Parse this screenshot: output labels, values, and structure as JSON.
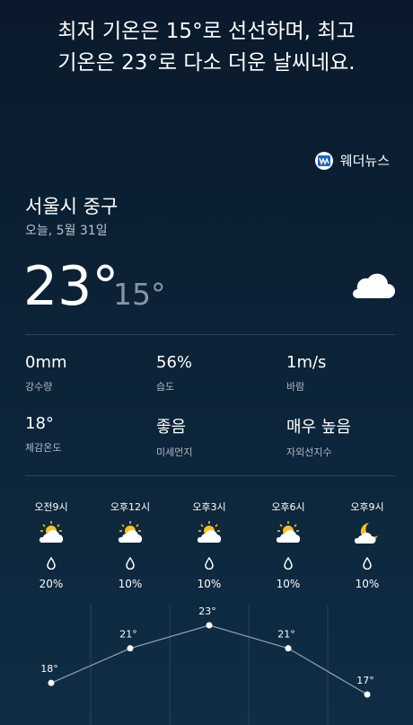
{
  "summary": {
    "line1": "최저 기온은 15°로 선선하며, 최고",
    "line2": "기온은 23°로 다소 더운 날씨네요."
  },
  "brand": {
    "name": "웨더뉴스",
    "icon": "weathernews-logo-icon"
  },
  "location": {
    "name": "서울시 중구",
    "date": "오늘, 5월 31일"
  },
  "current": {
    "temp": "23°",
    "min_temp": "15°",
    "icon": "cloud-icon"
  },
  "stats": [
    {
      "value": "0mm",
      "label": "강수량"
    },
    {
      "value": "56%",
      "label": "습도"
    },
    {
      "value": "1m/s",
      "label": "바람"
    },
    {
      "value": "18°",
      "label": "체감온도"
    },
    {
      "value": "좋음",
      "label": "미세먼지"
    },
    {
      "value": "매우 높음",
      "label": "자외선지수"
    }
  ],
  "hourly": [
    {
      "time": "오전9시",
      "icon": "partly-sunny-icon",
      "precip": "20%",
      "temp": 18,
      "temp_label": "18°"
    },
    {
      "time": "오후12시",
      "icon": "partly-sunny-icon",
      "precip": "10%",
      "temp": 21,
      "temp_label": "21°"
    },
    {
      "time": "오후3시",
      "icon": "partly-sunny-icon",
      "precip": "10%",
      "temp": 23,
      "temp_label": "23°"
    },
    {
      "time": "오후6시",
      "icon": "partly-sunny-icon",
      "precip": "10%",
      "temp": 21,
      "temp_label": "21°"
    },
    {
      "time": "오후9시",
      "icon": "moon-cloud-icon",
      "precip": "10%",
      "temp": 17,
      "temp_label": "17°"
    }
  ],
  "colors": {
    "sun": "#f2c230",
    "cloud": "#ffffff",
    "graph_line": "#8fa4b6"
  }
}
